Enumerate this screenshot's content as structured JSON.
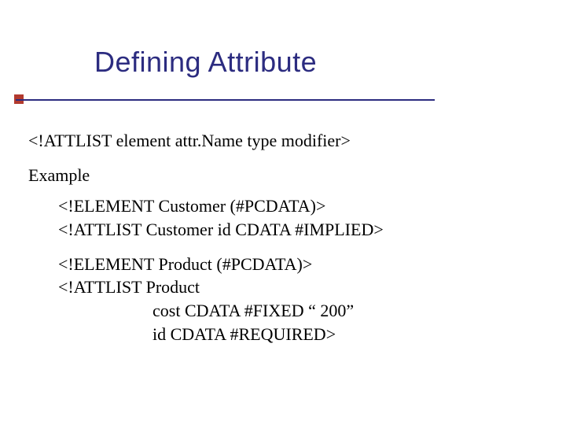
{
  "title": "Defining Attribute",
  "syntax": "<!ATTLIST element attr.Name type modifier>",
  "example_label": "Example",
  "block1": {
    "line1": "<!ELEMENT Customer (#PCDATA)>",
    "line2": "<!ATTLIST Customer id CDATA  #IMPLIED>"
  },
  "block2": {
    "line1": "<!ELEMENT Product (#PCDATA)>",
    "line2": "<!ATTLIST Product",
    "line3": "cost   CDATA  #FIXED “ 200”",
    "line4": "id     CDATA   #REQUIRED>"
  }
}
